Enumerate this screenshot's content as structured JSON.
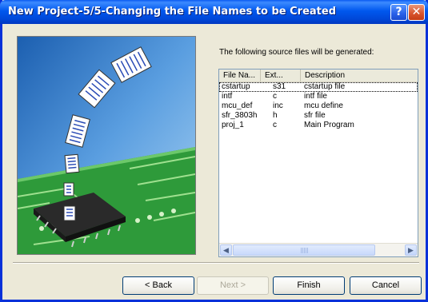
{
  "window": {
    "title": "New Project-5/5-Changing the File Names to be Created",
    "help_label": "?",
    "close_label": "✕"
  },
  "content": {
    "description": "The following source files will be generated:"
  },
  "file_list": {
    "columns": [
      "File Na...",
      "Ext...",
      "Description"
    ],
    "rows": [
      {
        "name": "cstartup",
        "ext": "s31",
        "description": "cstartup file"
      },
      {
        "name": "intf",
        "ext": "c",
        "description": "intf file"
      },
      {
        "name": "mcu_def",
        "ext": "inc",
        "description": "mcu define"
      },
      {
        "name": "sfr_3803h",
        "ext": "h",
        "description": "sfr file"
      },
      {
        "name": "proj_1",
        "ext": "c",
        "description": "Main Program"
      }
    ],
    "scroll_left_icon": "arrow-left-icon",
    "scroll_right_icon": "arrow-right-icon"
  },
  "buttons": {
    "back": "< Back",
    "next": "Next >",
    "finish": "Finish",
    "cancel": "Cancel"
  },
  "colors": {
    "titlebar": "#0054e3",
    "dialog_bg": "#ece9d8",
    "circuit_board": "#2e9a3a",
    "sky": "#3f7fc8"
  }
}
